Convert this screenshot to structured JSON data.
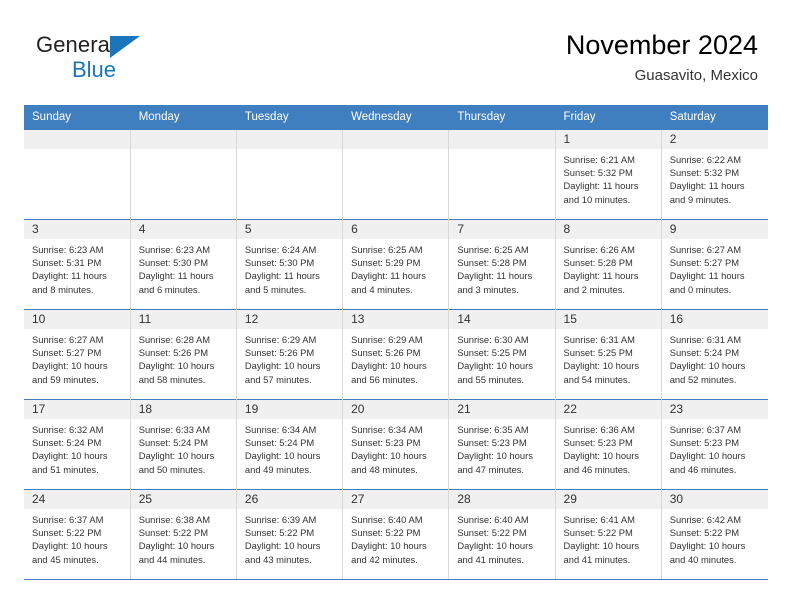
{
  "brand": {
    "name_part1": "General",
    "name_part2": "Blue",
    "logo_icon": "blue-triangle-icon",
    "accent_color": "#1b75bb"
  },
  "header": {
    "title": "November 2024",
    "location": "Guasavito, Mexico",
    "header_bg_color": "#3f7fbf"
  },
  "weekdays": [
    "Sunday",
    "Monday",
    "Tuesday",
    "Wednesday",
    "Thursday",
    "Friday",
    "Saturday"
  ],
  "labels": {
    "sunrise_prefix": "Sunrise:",
    "sunset_prefix": "Sunset:",
    "daylight_prefix": "Daylight:"
  },
  "weeks": [
    [
      {
        "day": ""
      },
      {
        "day": ""
      },
      {
        "day": ""
      },
      {
        "day": ""
      },
      {
        "day": ""
      },
      {
        "day": "1",
        "sunrise": "Sunrise: 6:21 AM",
        "sunset": "Sunset: 5:32 PM",
        "daylight": "Daylight: 11 hours and 10 minutes."
      },
      {
        "day": "2",
        "sunrise": "Sunrise: 6:22 AM",
        "sunset": "Sunset: 5:32 PM",
        "daylight": "Daylight: 11 hours and 9 minutes."
      }
    ],
    [
      {
        "day": "3",
        "sunrise": "Sunrise: 6:23 AM",
        "sunset": "Sunset: 5:31 PM",
        "daylight": "Daylight: 11 hours and 8 minutes."
      },
      {
        "day": "4",
        "sunrise": "Sunrise: 6:23 AM",
        "sunset": "Sunset: 5:30 PM",
        "daylight": "Daylight: 11 hours and 6 minutes."
      },
      {
        "day": "5",
        "sunrise": "Sunrise: 6:24 AM",
        "sunset": "Sunset: 5:30 PM",
        "daylight": "Daylight: 11 hours and 5 minutes."
      },
      {
        "day": "6",
        "sunrise": "Sunrise: 6:25 AM",
        "sunset": "Sunset: 5:29 PM",
        "daylight": "Daylight: 11 hours and 4 minutes."
      },
      {
        "day": "7",
        "sunrise": "Sunrise: 6:25 AM",
        "sunset": "Sunset: 5:28 PM",
        "daylight": "Daylight: 11 hours and 3 minutes."
      },
      {
        "day": "8",
        "sunrise": "Sunrise: 6:26 AM",
        "sunset": "Sunset: 5:28 PM",
        "daylight": "Daylight: 11 hours and 2 minutes."
      },
      {
        "day": "9",
        "sunrise": "Sunrise: 6:27 AM",
        "sunset": "Sunset: 5:27 PM",
        "daylight": "Daylight: 11 hours and 0 minutes."
      }
    ],
    [
      {
        "day": "10",
        "sunrise": "Sunrise: 6:27 AM",
        "sunset": "Sunset: 5:27 PM",
        "daylight": "Daylight: 10 hours and 59 minutes."
      },
      {
        "day": "11",
        "sunrise": "Sunrise: 6:28 AM",
        "sunset": "Sunset: 5:26 PM",
        "daylight": "Daylight: 10 hours and 58 minutes."
      },
      {
        "day": "12",
        "sunrise": "Sunrise: 6:29 AM",
        "sunset": "Sunset: 5:26 PM",
        "daylight": "Daylight: 10 hours and 57 minutes."
      },
      {
        "day": "13",
        "sunrise": "Sunrise: 6:29 AM",
        "sunset": "Sunset: 5:26 PM",
        "daylight": "Daylight: 10 hours and 56 minutes."
      },
      {
        "day": "14",
        "sunrise": "Sunrise: 6:30 AM",
        "sunset": "Sunset: 5:25 PM",
        "daylight": "Daylight: 10 hours and 55 minutes."
      },
      {
        "day": "15",
        "sunrise": "Sunrise: 6:31 AM",
        "sunset": "Sunset: 5:25 PM",
        "daylight": "Daylight: 10 hours and 54 minutes."
      },
      {
        "day": "16",
        "sunrise": "Sunrise: 6:31 AM",
        "sunset": "Sunset: 5:24 PM",
        "daylight": "Daylight: 10 hours and 52 minutes."
      }
    ],
    [
      {
        "day": "17",
        "sunrise": "Sunrise: 6:32 AM",
        "sunset": "Sunset: 5:24 PM",
        "daylight": "Daylight: 10 hours and 51 minutes."
      },
      {
        "day": "18",
        "sunrise": "Sunrise: 6:33 AM",
        "sunset": "Sunset: 5:24 PM",
        "daylight": "Daylight: 10 hours and 50 minutes."
      },
      {
        "day": "19",
        "sunrise": "Sunrise: 6:34 AM",
        "sunset": "Sunset: 5:24 PM",
        "daylight": "Daylight: 10 hours and 49 minutes."
      },
      {
        "day": "20",
        "sunrise": "Sunrise: 6:34 AM",
        "sunset": "Sunset: 5:23 PM",
        "daylight": "Daylight: 10 hours and 48 minutes."
      },
      {
        "day": "21",
        "sunrise": "Sunrise: 6:35 AM",
        "sunset": "Sunset: 5:23 PM",
        "daylight": "Daylight: 10 hours and 47 minutes."
      },
      {
        "day": "22",
        "sunrise": "Sunrise: 6:36 AM",
        "sunset": "Sunset: 5:23 PM",
        "daylight": "Daylight: 10 hours and 46 minutes."
      },
      {
        "day": "23",
        "sunrise": "Sunrise: 6:37 AM",
        "sunset": "Sunset: 5:23 PM",
        "daylight": "Daylight: 10 hours and 46 minutes."
      }
    ],
    [
      {
        "day": "24",
        "sunrise": "Sunrise: 6:37 AM",
        "sunset": "Sunset: 5:22 PM",
        "daylight": "Daylight: 10 hours and 45 minutes."
      },
      {
        "day": "25",
        "sunrise": "Sunrise: 6:38 AM",
        "sunset": "Sunset: 5:22 PM",
        "daylight": "Daylight: 10 hours and 44 minutes."
      },
      {
        "day": "26",
        "sunrise": "Sunrise: 6:39 AM",
        "sunset": "Sunset: 5:22 PM",
        "daylight": "Daylight: 10 hours and 43 minutes."
      },
      {
        "day": "27",
        "sunrise": "Sunrise: 6:40 AM",
        "sunset": "Sunset: 5:22 PM",
        "daylight": "Daylight: 10 hours and 42 minutes."
      },
      {
        "day": "28",
        "sunrise": "Sunrise: 6:40 AM",
        "sunset": "Sunset: 5:22 PM",
        "daylight": "Daylight: 10 hours and 41 minutes."
      },
      {
        "day": "29",
        "sunrise": "Sunrise: 6:41 AM",
        "sunset": "Sunset: 5:22 PM",
        "daylight": "Daylight: 10 hours and 41 minutes."
      },
      {
        "day": "30",
        "sunrise": "Sunrise: 6:42 AM",
        "sunset": "Sunset: 5:22 PM",
        "daylight": "Daylight: 10 hours and 40 minutes."
      }
    ]
  ]
}
